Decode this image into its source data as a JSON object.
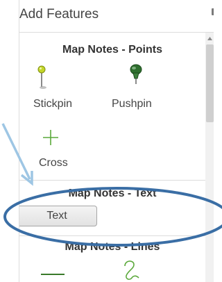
{
  "panel": {
    "title": "Add Features"
  },
  "sections": [
    {
      "heading": "Map Notes - Points",
      "tools": [
        {
          "label": "Stickpin",
          "icon": "stickpin-icon"
        },
        {
          "label": "Pushpin",
          "icon": "pushpin-icon"
        },
        {
          "label": "Cross",
          "icon": "cross-icon"
        }
      ]
    },
    {
      "heading": "Map Notes - Text",
      "tools": [
        {
          "label": "Text",
          "icon": "text-tool"
        }
      ]
    },
    {
      "heading": "Map Notes - Lines",
      "tools": [
        {
          "icon": "line-icon"
        },
        {
          "icon": "freehand-line-icon"
        }
      ]
    }
  ],
  "annotation": {
    "color": "#3a6ea5",
    "arrow_color": "#9ec6e4",
    "shape": "ellipse-highlight"
  },
  "colors": {
    "stickpin_head": "#c4d62a",
    "pushpin_head": "#2f6f2f",
    "cross": "#5aa83a",
    "line": "#3a7a2a"
  }
}
